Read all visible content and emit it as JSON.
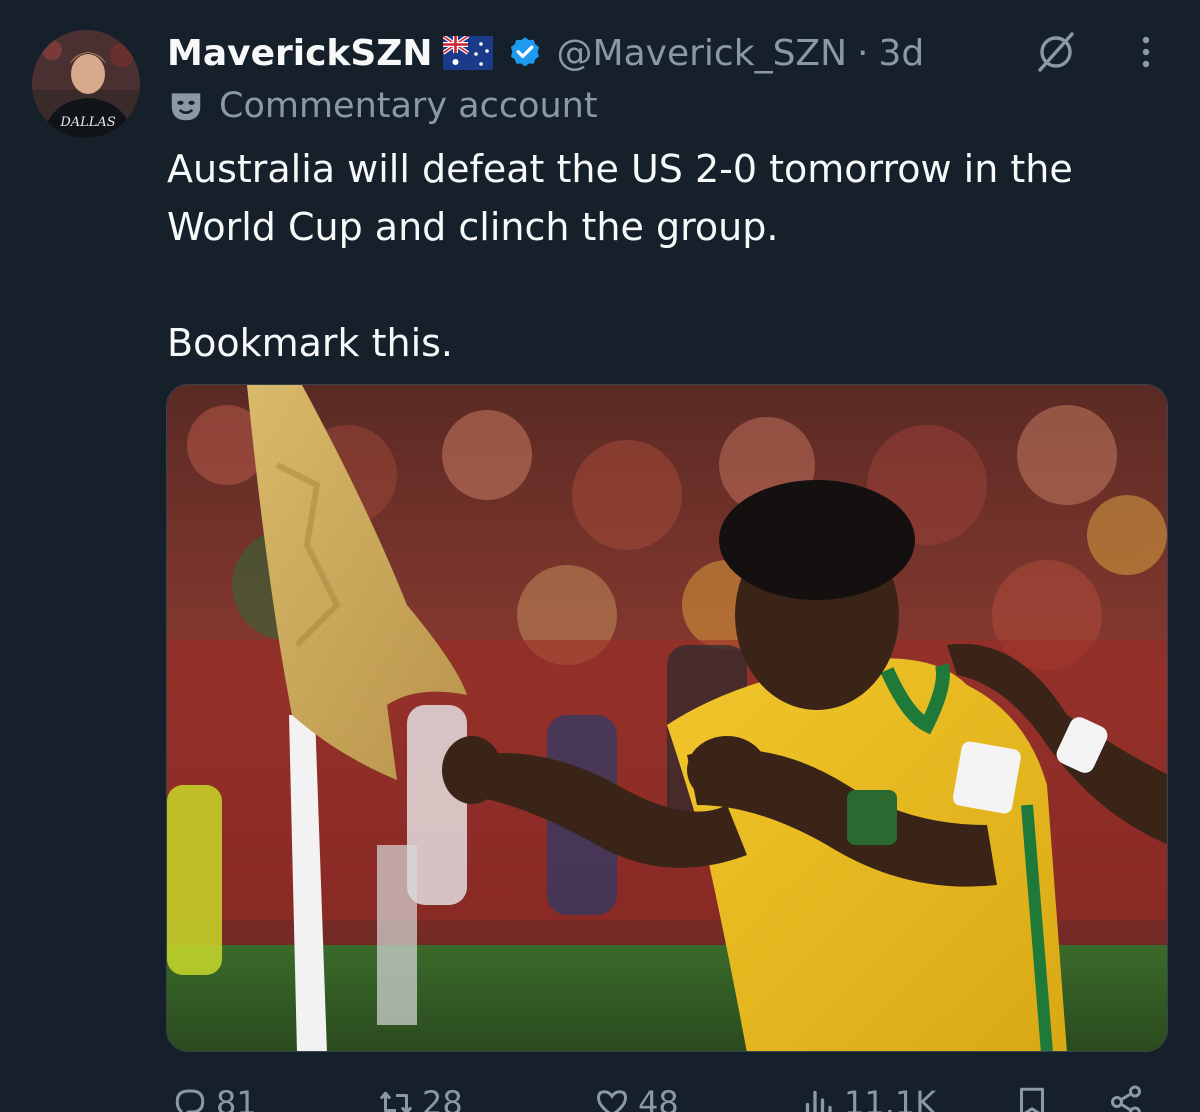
{
  "tweet": {
    "author": {
      "display_name": "MaverickSZN",
      "handle": "@Maverick_SZN",
      "time_ago": "3d",
      "separator": "·",
      "avatar_shirt_text": "DALLAS",
      "flag_icon": "australia-flag-icon",
      "verified_icon": "verified-badge-icon"
    },
    "label": {
      "text": "Commentary account",
      "icon": "mask-icon"
    },
    "body": {
      "line1": "Australia will defeat the US 2-0 tomorrow in the",
      "line2": "World Cup and clinch the group.",
      "line3": "Bookmark this."
    },
    "media": {
      "alt_icon": "photo-footballer-celebrating"
    },
    "actions": {
      "replies": "81",
      "reposts": "28",
      "likes": "48",
      "views": "11.1K"
    }
  },
  "colors": {
    "background": "#15202b",
    "primary_text": "#f7f9f9",
    "secondary_text": "#8b98a5",
    "verified_blue": "#1d9bf0"
  }
}
